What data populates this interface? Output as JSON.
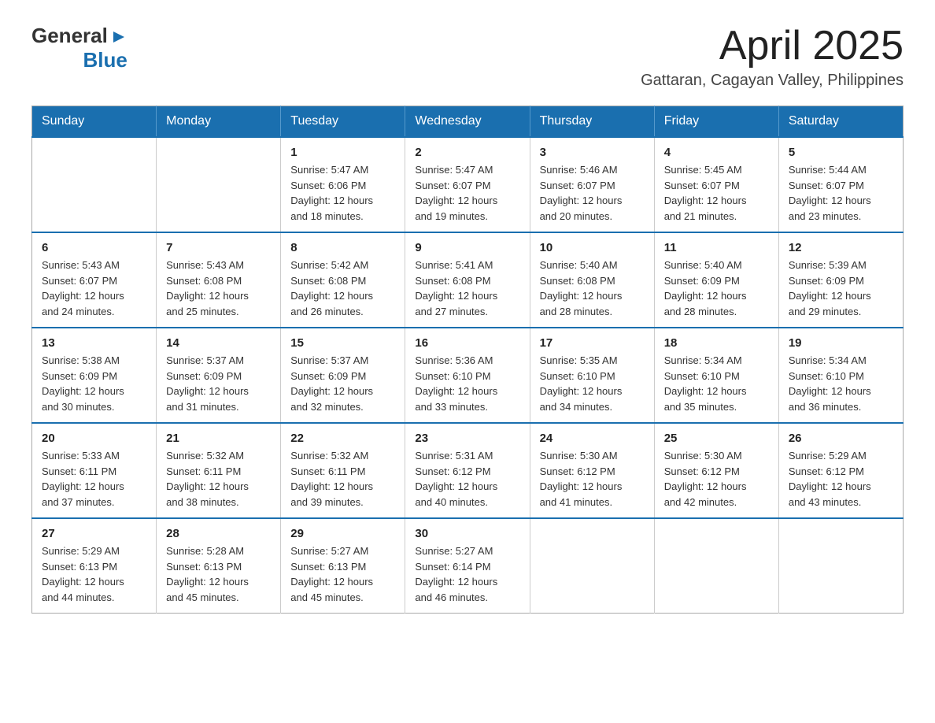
{
  "logo": {
    "text_general": "General",
    "text_blue": "Blue",
    "triangle": "▶"
  },
  "title": "April 2025",
  "subtitle": "Gattaran, Cagayan Valley, Philippines",
  "days_of_week": [
    "Sunday",
    "Monday",
    "Tuesday",
    "Wednesday",
    "Thursday",
    "Friday",
    "Saturday"
  ],
  "weeks": [
    [
      {
        "day": "",
        "info": ""
      },
      {
        "day": "",
        "info": ""
      },
      {
        "day": "1",
        "info": "Sunrise: 5:47 AM\nSunset: 6:06 PM\nDaylight: 12 hours\nand 18 minutes."
      },
      {
        "day": "2",
        "info": "Sunrise: 5:47 AM\nSunset: 6:07 PM\nDaylight: 12 hours\nand 19 minutes."
      },
      {
        "day": "3",
        "info": "Sunrise: 5:46 AM\nSunset: 6:07 PM\nDaylight: 12 hours\nand 20 minutes."
      },
      {
        "day": "4",
        "info": "Sunrise: 5:45 AM\nSunset: 6:07 PM\nDaylight: 12 hours\nand 21 minutes."
      },
      {
        "day": "5",
        "info": "Sunrise: 5:44 AM\nSunset: 6:07 PM\nDaylight: 12 hours\nand 23 minutes."
      }
    ],
    [
      {
        "day": "6",
        "info": "Sunrise: 5:43 AM\nSunset: 6:07 PM\nDaylight: 12 hours\nand 24 minutes."
      },
      {
        "day": "7",
        "info": "Sunrise: 5:43 AM\nSunset: 6:08 PM\nDaylight: 12 hours\nand 25 minutes."
      },
      {
        "day": "8",
        "info": "Sunrise: 5:42 AM\nSunset: 6:08 PM\nDaylight: 12 hours\nand 26 minutes."
      },
      {
        "day": "9",
        "info": "Sunrise: 5:41 AM\nSunset: 6:08 PM\nDaylight: 12 hours\nand 27 minutes."
      },
      {
        "day": "10",
        "info": "Sunrise: 5:40 AM\nSunset: 6:08 PM\nDaylight: 12 hours\nand 28 minutes."
      },
      {
        "day": "11",
        "info": "Sunrise: 5:40 AM\nSunset: 6:09 PM\nDaylight: 12 hours\nand 28 minutes."
      },
      {
        "day": "12",
        "info": "Sunrise: 5:39 AM\nSunset: 6:09 PM\nDaylight: 12 hours\nand 29 minutes."
      }
    ],
    [
      {
        "day": "13",
        "info": "Sunrise: 5:38 AM\nSunset: 6:09 PM\nDaylight: 12 hours\nand 30 minutes."
      },
      {
        "day": "14",
        "info": "Sunrise: 5:37 AM\nSunset: 6:09 PM\nDaylight: 12 hours\nand 31 minutes."
      },
      {
        "day": "15",
        "info": "Sunrise: 5:37 AM\nSunset: 6:09 PM\nDaylight: 12 hours\nand 32 minutes."
      },
      {
        "day": "16",
        "info": "Sunrise: 5:36 AM\nSunset: 6:10 PM\nDaylight: 12 hours\nand 33 minutes."
      },
      {
        "day": "17",
        "info": "Sunrise: 5:35 AM\nSunset: 6:10 PM\nDaylight: 12 hours\nand 34 minutes."
      },
      {
        "day": "18",
        "info": "Sunrise: 5:34 AM\nSunset: 6:10 PM\nDaylight: 12 hours\nand 35 minutes."
      },
      {
        "day": "19",
        "info": "Sunrise: 5:34 AM\nSunset: 6:10 PM\nDaylight: 12 hours\nand 36 minutes."
      }
    ],
    [
      {
        "day": "20",
        "info": "Sunrise: 5:33 AM\nSunset: 6:11 PM\nDaylight: 12 hours\nand 37 minutes."
      },
      {
        "day": "21",
        "info": "Sunrise: 5:32 AM\nSunset: 6:11 PM\nDaylight: 12 hours\nand 38 minutes."
      },
      {
        "day": "22",
        "info": "Sunrise: 5:32 AM\nSunset: 6:11 PM\nDaylight: 12 hours\nand 39 minutes."
      },
      {
        "day": "23",
        "info": "Sunrise: 5:31 AM\nSunset: 6:12 PM\nDaylight: 12 hours\nand 40 minutes."
      },
      {
        "day": "24",
        "info": "Sunrise: 5:30 AM\nSunset: 6:12 PM\nDaylight: 12 hours\nand 41 minutes."
      },
      {
        "day": "25",
        "info": "Sunrise: 5:30 AM\nSunset: 6:12 PM\nDaylight: 12 hours\nand 42 minutes."
      },
      {
        "day": "26",
        "info": "Sunrise: 5:29 AM\nSunset: 6:12 PM\nDaylight: 12 hours\nand 43 minutes."
      }
    ],
    [
      {
        "day": "27",
        "info": "Sunrise: 5:29 AM\nSunset: 6:13 PM\nDaylight: 12 hours\nand 44 minutes."
      },
      {
        "day": "28",
        "info": "Sunrise: 5:28 AM\nSunset: 6:13 PM\nDaylight: 12 hours\nand 45 minutes."
      },
      {
        "day": "29",
        "info": "Sunrise: 5:27 AM\nSunset: 6:13 PM\nDaylight: 12 hours\nand 45 minutes."
      },
      {
        "day": "30",
        "info": "Sunrise: 5:27 AM\nSunset: 6:14 PM\nDaylight: 12 hours\nand 46 minutes."
      },
      {
        "day": "",
        "info": ""
      },
      {
        "day": "",
        "info": ""
      },
      {
        "day": "",
        "info": ""
      }
    ]
  ]
}
